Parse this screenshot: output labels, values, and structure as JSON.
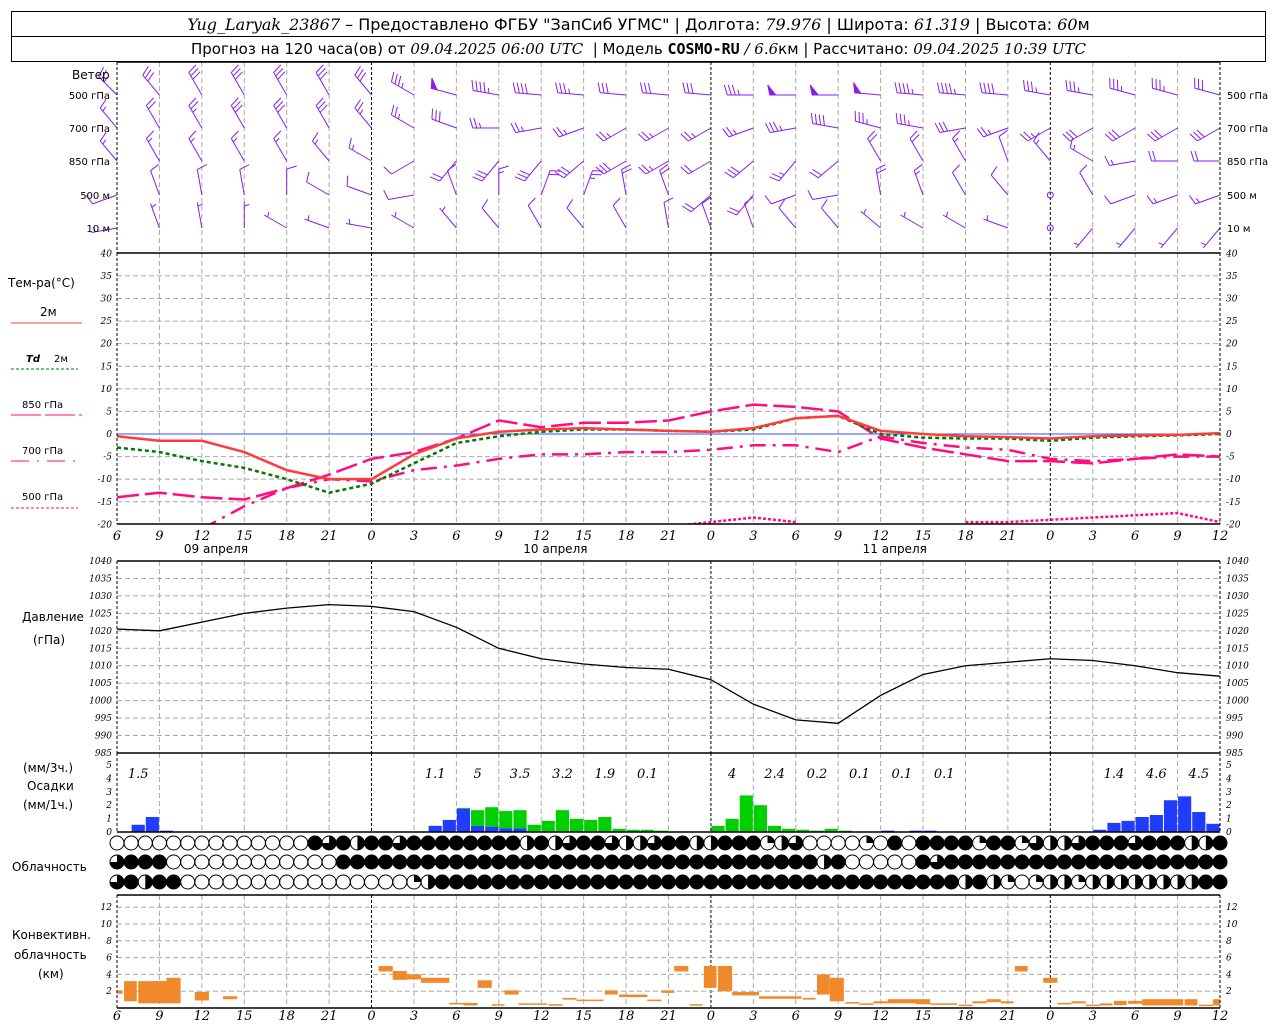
{
  "header": {
    "station": "Yug_Laryak_23867",
    "provider": " – Предоставлено ФГБУ \"ЗапСиб УГМС\" | ",
    "lon_label": "Долгота: ",
    "lon": "79.976",
    "lat_label": " | Широта: ",
    "lat": "61.319",
    "alt_label": " | Высота: ",
    "alt": "60",
    "alt_unit": "м",
    "forecast_label": "Прогноз на 120 часа(ов) от ",
    "forecast_from": "09.04.2025 06:00 UTC",
    "model_label": "  | Модель ",
    "model": "COSMO-RU",
    "model_res": " / 6.6",
    "model_res_unit": "км",
    "computed_label": " | Рассчитано: ",
    "computed": "09.04.2025 10:39 UTC"
  },
  "labels": {
    "wind": "Ветер",
    "levels": [
      "500 гПа",
      "700 гПа",
      "850 гПа",
      "500 м",
      "10  м"
    ],
    "temp_title": "Тем-ра(°C)",
    "t2m": "2м",
    "td_sym": "Td",
    "td2m": "2м",
    "t850": "850 гПа",
    "t700": "700 гПа",
    "t500": "500 гПа",
    "pressure": "Давление",
    "pressure_unit": "(гПа)",
    "precip_3h": "(мм/3ч.)",
    "precip": "Осадки",
    "precip_1h": "(мм/1ч.)",
    "cloud": "Облачность",
    "conv1": "Конвективн.",
    "conv2": "облачность",
    "conv3": "(км)"
  },
  "colors": {
    "wind": "#8a1ee8",
    "t2m": "#ff3c3c",
    "td2m": "#007a00",
    "t850": "#ff0c80",
    "t700": "#ff0c80",
    "t500": "#ff0c80",
    "zero_line": "#3050ff",
    "pressure": "#000000",
    "precip_solid": "#1f3cff",
    "precip_liquid": "#00d000",
    "convective": "#f0882c"
  },
  "time_axis": {
    "hour_labels": [
      "6",
      "9",
      "12",
      "15",
      "18",
      "21",
      "0",
      "3",
      "6",
      "9",
      "12",
      "15",
      "18",
      "21",
      "0",
      "3",
      "6",
      "9",
      "12",
      "15",
      "18",
      "21",
      "0",
      "3",
      "6",
      "9",
      "12"
    ],
    "dates": [
      "09 апреля",
      "10 апреля",
      "11 апреля"
    ]
  },
  "chart_data": [
    {
      "type": "barbs",
      "levels": [
        "500 гПа",
        "700 гПа",
        "850 гПа",
        "500 м",
        "10 м"
      ],
      "step_hours": 3,
      "direction_deg": [
        [
          315,
          320,
          330,
          330,
          330,
          330,
          320,
          300,
          285,
          280,
          275,
          275,
          275,
          275,
          275,
          270,
          270,
          270,
          275,
          275,
          275,
          275,
          280,
          280,
          285,
          285,
          285
        ],
        [
          320,
          330,
          330,
          330,
          330,
          330,
          320,
          300,
          290,
          270,
          260,
          250,
          240,
          240,
          240,
          250,
          260,
          280,
          285,
          280,
          260,
          250,
          240,
          240,
          240,
          240,
          240
        ],
        [
          320,
          330,
          330,
          330,
          330,
          320,
          300,
          240,
          220,
          220,
          220,
          230,
          240,
          240,
          240,
          230,
          220,
          230,
          330,
          330,
          330,
          340,
          320,
          300,
          260,
          270,
          270
        ],
        [
          250,
          340,
          350,
          350,
          0,
          300,
          290,
          260,
          340,
          0,
          20,
          20,
          350,
          340,
          230,
          220,
          250,
          260,
          350,
          340,
          330,
          320,
          0,
          330,
          250,
          250,
          250
        ],
        [
          260,
          340,
          350,
          0,
          300,
          290,
          280,
          300,
          320,
          320,
          330,
          320,
          330,
          350,
          340,
          340,
          320,
          320,
          310,
          300,
          300,
          290,
          0,
          220,
          220,
          220,
          220
        ]
      ],
      "speed": [
        [
          25,
          30,
          30,
          30,
          30,
          30,
          30,
          35,
          50,
          45,
          40,
          35,
          30,
          30,
          30,
          35,
          50,
          50,
          50,
          45,
          45,
          40,
          35,
          35,
          35,
          35,
          30
        ],
        [
          15,
          20,
          25,
          30,
          30,
          30,
          25,
          25,
          30,
          25,
          25,
          25,
          25,
          25,
          25,
          25,
          35,
          40,
          35,
          35,
          30,
          25,
          25,
          30,
          30,
          30,
          30
        ],
        [
          15,
          15,
          15,
          15,
          15,
          15,
          15,
          10,
          20,
          30,
          30,
          30,
          30,
          25,
          20,
          30,
          25,
          20,
          20,
          20,
          15,
          10,
          15,
          15,
          15,
          20,
          20
        ],
        [
          10,
          10,
          10,
          10,
          10,
          10,
          10,
          10,
          10,
          15,
          20,
          25,
          20,
          20,
          20,
          20,
          10,
          10,
          20,
          15,
          10,
          10,
          0,
          10,
          10,
          15,
          15
        ],
        [
          5,
          5,
          5,
          5,
          5,
          5,
          5,
          5,
          5,
          10,
          10,
          10,
          10,
          10,
          10,
          10,
          10,
          10,
          5,
          5,
          5,
          5,
          0,
          5,
          5,
          5,
          5
        ]
      ]
    },
    {
      "type": "line",
      "ylabel": "Тем-ра(°C)",
      "ylim": [
        -20,
        40
      ],
      "yticks": [
        -20,
        -15,
        -10,
        -5,
        0,
        5,
        10,
        15,
        20,
        25,
        30,
        35,
        40
      ],
      "step_hours": 3,
      "series": [
        {
          "name": "2м",
          "values": [
            -0.5,
            -1.5,
            -1.5,
            -4,
            -8,
            -10,
            -10,
            -4.5,
            -1,
            0.5,
            1,
            1.3,
            1,
            0.7,
            0.5,
            1.3,
            3.5,
            4,
            0.7,
            0,
            -0.5,
            -0.7,
            -1,
            -0.5,
            -0.3,
            -0.2,
            0.2
          ]
        },
        {
          "name": "Td 2м",
          "values": [
            -3,
            -4,
            -6,
            -7.5,
            -10,
            -13,
            -11,
            -6.5,
            -2,
            -0.5,
            0.5,
            1,
            1,
            0.7,
            0.5,
            1,
            3.5,
            4,
            0,
            -0.8,
            -1,
            -1,
            -1.5,
            -0.8,
            -0.5,
            -0.3,
            0
          ]
        },
        {
          "name": "850 гПа",
          "values": [
            -14,
            -13,
            -14,
            -14.5,
            -12,
            -9,
            -5.5,
            -4,
            -1,
            3,
            1.5,
            2.5,
            2.5,
            3,
            5,
            6.5,
            6,
            5,
            -1,
            -3,
            -4.5,
            -6,
            -6,
            -6.5,
            -5.5,
            -4.5,
            -5
          ]
        },
        {
          "name": "700 гПа",
          "values": [
            null,
            null,
            -21,
            -16,
            -12,
            -10,
            -10.5,
            -8,
            -7,
            -5.5,
            -4.5,
            -4.5,
            -4,
            -4,
            -3.5,
            -2.5,
            -2.5,
            -4,
            -0.5,
            -2,
            -3,
            -3.5,
            -5.5,
            -6,
            -5.5,
            -5,
            -5
          ]
        },
        {
          "name": "500 гПа",
          "values": [
            null,
            null,
            null,
            null,
            null,
            null,
            null,
            null,
            null,
            null,
            null,
            null,
            null,
            -20.5,
            -19.5,
            -18.5,
            -19.5,
            null,
            null,
            null,
            -19.5,
            -19.5,
            -19,
            -18.5,
            -18,
            -17.5,
            -19.5
          ]
        }
      ]
    },
    {
      "type": "line",
      "ylabel": "Давление (гПа)",
      "ylim": [
        985,
        1040
      ],
      "yticks": [
        985,
        990,
        995,
        1000,
        1005,
        1010,
        1015,
        1020,
        1025,
        1030,
        1035,
        1040
      ],
      "step_hours": 3,
      "values": [
        1020.5,
        1020,
        1022.5,
        1025,
        1026.5,
        1027.5,
        1027,
        1025.5,
        1021,
        1015,
        1012,
        1010.5,
        1009.5,
        1009,
        1006,
        999,
        994.5,
        993.5,
        1001.5,
        1007.5,
        1010,
        1011,
        1012,
        1011.5,
        1010,
        1008,
        1007
      ]
    },
    {
      "type": "bar",
      "ylabel": "Осадки",
      "ylim": [
        0,
        5.5
      ],
      "yticks": [
        0,
        1,
        2,
        3,
        4,
        5
      ],
      "hourly_columns": [
        "hour",
        "solid",
        "liquid"
      ],
      "hourly": [
        [
          1,
          0.54,
          0
        ],
        [
          2,
          1.12,
          0
        ],
        [
          3,
          0.1,
          0
        ],
        [
          22,
          0.46,
          0
        ],
        [
          23,
          0.9,
          0
        ],
        [
          24,
          1.73,
          0.07
        ],
        [
          25,
          0.46,
          1.17
        ],
        [
          26,
          0.4,
          1.45
        ],
        [
          27,
          0.27,
          1.29
        ],
        [
          28,
          0.27,
          1.36
        ],
        [
          29,
          0,
          0.54
        ],
        [
          30,
          0,
          0.83
        ],
        [
          31,
          0,
          1.63
        ],
        [
          32,
          0,
          0.98
        ],
        [
          33,
          0,
          0.9
        ],
        [
          34,
          0,
          1.12
        ],
        [
          35,
          0,
          0.24
        ],
        [
          36,
          0,
          0.17
        ],
        [
          37,
          0,
          0.17
        ],
        [
          38,
          0,
          0.1
        ],
        [
          42,
          0,
          0.46
        ],
        [
          43,
          0,
          0.98
        ],
        [
          44,
          0,
          2.73
        ],
        [
          45,
          0,
          2.0
        ],
        [
          46,
          0,
          0.46
        ],
        [
          47,
          0,
          0.24
        ],
        [
          48,
          0,
          0.17
        ],
        [
          49,
          0,
          0.1
        ],
        [
          50,
          0,
          0.24
        ],
        [
          51,
          0,
          0.1
        ],
        [
          54,
          0.1,
          0
        ],
        [
          56,
          0.1,
          0
        ],
        [
          57,
          0.1,
          0
        ],
        [
          69,
          0.17,
          0
        ],
        [
          70,
          0.68,
          0
        ],
        [
          71,
          0.83,
          0
        ],
        [
          72,
          1.12,
          0
        ],
        [
          73,
          1.27,
          0
        ],
        [
          74,
          2.37,
          0
        ],
        [
          75,
          2.66,
          0
        ],
        [
          76,
          1.49,
          0
        ],
        [
          77,
          0.61,
          0
        ]
      ],
      "totals_3h": [
        "1.5",
        "",
        "",
        "",
        "",
        "",
        "",
        "1.1",
        "5",
        "3.5",
        "3.2",
        "1.9",
        "0.1",
        "",
        "4",
        "2.4",
        "0.2",
        "0.1",
        "0.1",
        "0.1",
        "",
        "",
        "",
        "1.4",
        "4.6",
        "4.5"
      ]
    },
    {
      "type": "table",
      "name": "Облачность",
      "encoding": "0=ясно,1=1/4,2=1/2,3=3/4,4=сплошная",
      "rows": [
        "0000000000000043424434444444424234432234422444123000010404444144132234443444224",
        "3444000000000000444444444444444444444444444444444424000004344444444444444444444",
        "3424400000000000000001244444444444444444444444444444444444442421012212222222244"
      ]
    },
    {
      "type": "bar",
      "ylabel": "Конвективн. облачность (км)",
      "ylim": [
        0,
        13
      ],
      "yticks": [
        0,
        2,
        4,
        6,
        8,
        10,
        12
      ],
      "columns": [
        "hour_from",
        "hour_to",
        "base_km",
        "top_km"
      ],
      "bars": [
        [
          0,
          0.4,
          1.7,
          2.1
        ],
        [
          0.5,
          1.4,
          0.8,
          3.2
        ],
        [
          1.5,
          3.5,
          0.55,
          3.2
        ],
        [
          3.5,
          4.5,
          0.55,
          3.6
        ],
        [
          5.5,
          6.5,
          0.9,
          1.9
        ],
        [
          7.5,
          8.5,
          1.05,
          1.4
        ],
        [
          18.5,
          19.5,
          4.35,
          5.0
        ],
        [
          19.5,
          20.5,
          3.35,
          4.4
        ],
        [
          20.5,
          21.5,
          3.4,
          4.0
        ],
        [
          21.5,
          23.5,
          3.0,
          3.6
        ],
        [
          23.5,
          24.5,
          0.45,
          0.6
        ],
        [
          24.5,
          25.5,
          0.3,
          0.6
        ],
        [
          25.5,
          26.5,
          2.4,
          3.3
        ],
        [
          26.5,
          27.4,
          0.3,
          0.45
        ],
        [
          27.4,
          28.4,
          1.6,
          2.1
        ],
        [
          28.4,
          29.4,
          0.45,
          0.55
        ],
        [
          29.4,
          30.4,
          0.45,
          0.55
        ],
        [
          30.5,
          31.5,
          0.3,
          0.45
        ],
        [
          31.5,
          32.5,
          1.0,
          1.2
        ],
        [
          32.5,
          34.4,
          0.85,
          1.0
        ],
        [
          34.5,
          35.4,
          1.6,
          2.1
        ],
        [
          35.5,
          37.5,
          1.3,
          1.6
        ],
        [
          37.5,
          38.5,
          0.85,
          1.0
        ],
        [
          38.5,
          39.4,
          1.8,
          2.1
        ],
        [
          39.4,
          40.4,
          4.35,
          5.0
        ],
        [
          40.5,
          41.4,
          0.3,
          0.45
        ],
        [
          41.5,
          42.4,
          2.4,
          5.0
        ],
        [
          42.5,
          43.5,
          2.0,
          5.0
        ],
        [
          43.5,
          45.4,
          1.5,
          1.9
        ],
        [
          45.4,
          48.4,
          1.1,
          1.4
        ],
        [
          48.5,
          49.4,
          1.0,
          1.2
        ],
        [
          49.5,
          50.4,
          1.6,
          4.0
        ],
        [
          50.4,
          51.4,
          0.8,
          3.6
        ],
        [
          51.5,
          52.5,
          0.55,
          0.7
        ],
        [
          52.5,
          53.5,
          0.45,
          0.55
        ],
        [
          53.5,
          54.5,
          0.55,
          0.8
        ],
        [
          54.5,
          56.5,
          0.55,
          1.05
        ],
        [
          56.5,
          57.5,
          0.45,
          1.05
        ],
        [
          57.5,
          59.4,
          0.45,
          0.55
        ],
        [
          59.5,
          60.5,
          0.3,
          0.4
        ],
        [
          60.5,
          61.5,
          0.55,
          0.8
        ],
        [
          61.5,
          62.5,
          0.7,
          1.05
        ],
        [
          62.5,
          63.4,
          0.55,
          0.8
        ],
        [
          63.5,
          64.4,
          4.35,
          5.0
        ],
        [
          65.5,
          66.5,
          3.0,
          3.6
        ],
        [
          66.5,
          67.5,
          0.55,
          0.6
        ],
        [
          67.5,
          68.5,
          0.55,
          0.8
        ],
        [
          68.5,
          69.5,
          0.3,
          0.4
        ],
        [
          69.5,
          70.4,
          0.3,
          0.55
        ],
        [
          70.5,
          71.4,
          0.35,
          0.85
        ],
        [
          71.5,
          72.5,
          0.5,
          0.85
        ],
        [
          72.5,
          75.4,
          0.3,
          1.05
        ],
        [
          75.5,
          76.4,
          0.3,
          1.05
        ],
        [
          76.5,
          77.5,
          0.3,
          0.4
        ],
        [
          77.5,
          78,
          0.3,
          1.05
        ]
      ]
    }
  ]
}
